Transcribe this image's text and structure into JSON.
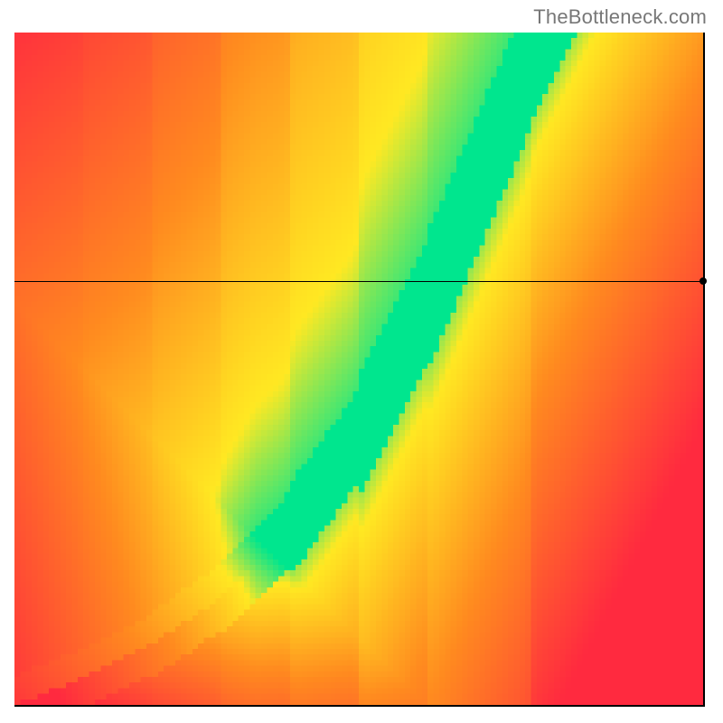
{
  "attribution": "TheBottleneck.com",
  "colors": {
    "red": "#ff2a3f",
    "orange": "#ff8a1f",
    "yellow": "#ffe822",
    "green": "#00e68e"
  },
  "chart_data": {
    "type": "heatmap",
    "title": "",
    "xlabel": "",
    "ylabel": "",
    "xlim": [
      0,
      100
    ],
    "ylim": [
      0,
      100
    ],
    "reference_line_y": 63,
    "reference_dot": {
      "x": 100,
      "y": 63
    },
    "optimal_curve": [
      {
        "x": 0,
        "y": 0
      },
      {
        "x": 10,
        "y": 4
      },
      {
        "x": 20,
        "y": 9
      },
      {
        "x": 30,
        "y": 16
      },
      {
        "x": 40,
        "y": 26
      },
      {
        "x": 50,
        "y": 40
      },
      {
        "x": 55,
        "y": 50
      },
      {
        "x": 60,
        "y": 60
      },
      {
        "x": 65,
        "y": 72
      },
      {
        "x": 70,
        "y": 84
      },
      {
        "x": 75,
        "y": 96
      },
      {
        "x": 77,
        "y": 100
      }
    ],
    "optimal_band_width": 8,
    "color_stops": [
      {
        "distance": 0,
        "color": "#00e68e"
      },
      {
        "distance": 10,
        "color": "#ffe822"
      },
      {
        "distance": 35,
        "color": "#ff8a1f"
      },
      {
        "distance": 70,
        "color": "#ff2a3f"
      }
    ],
    "description": "Heat map where the green ridge indicates balanced pairing along a curved diagonal; deviation in either axis direction shifts toward yellow, orange, then red."
  }
}
